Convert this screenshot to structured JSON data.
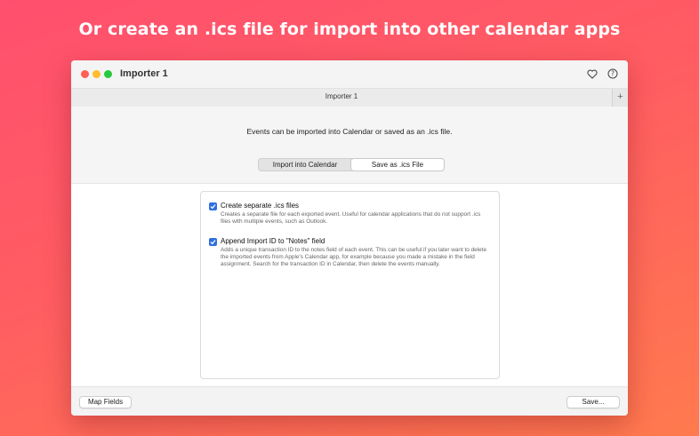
{
  "headline": "Or create an .ics file for import into other calendar apps",
  "window": {
    "title": "Importer 1",
    "icons": [
      "heart-icon",
      "help-icon"
    ]
  },
  "tabbar": {
    "tab_label": "Importer 1",
    "add_label": "+"
  },
  "top_panel": {
    "intro": "Events can be imported into Calendar or saved as an .ics file.",
    "segments": [
      "Import into Calendar",
      "Save as .ics File"
    ],
    "selected_segment": "Save as .ics File"
  },
  "options": [
    {
      "checked": true,
      "title": "Create separate .ics files",
      "description": "Creates a separate file for each exported event. Useful for calendar applications that do not support .ics files with multiple events, such as Outlook."
    },
    {
      "checked": true,
      "title": "Append Import ID to \"Notes\" field",
      "description": "Adds a unique transaction ID to the notes field of each event. This can be useful if you later want to delete the imported events from Apple's Calendar app, for example because you made a mistake in the field assignment. Search for the transaction ID in Calendar, then delete the events manually."
    }
  ],
  "bottombar": {
    "map_fields_label": "Map Fields",
    "save_label": "Save..."
  },
  "colors": {
    "accent": "#2f6fe0",
    "background_gradient": [
      "#ff4f6e",
      "#ff7a4e"
    ]
  }
}
